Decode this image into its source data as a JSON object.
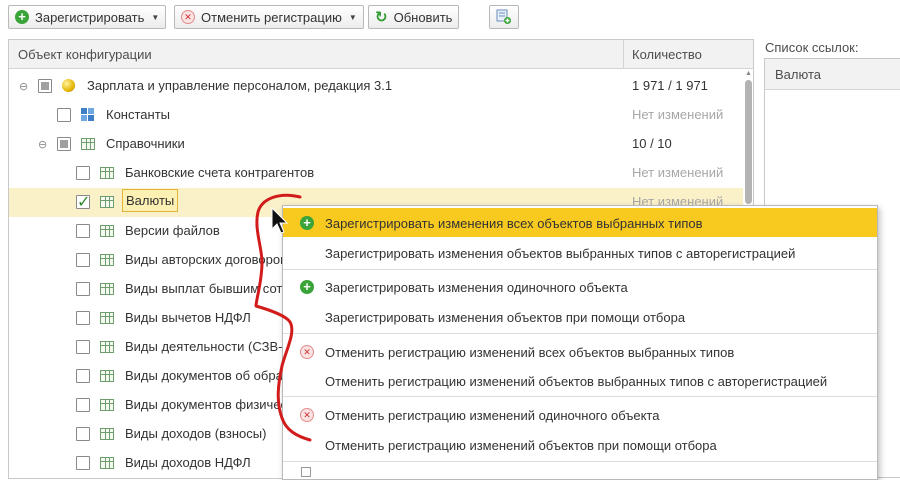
{
  "toolbar": {
    "register_label": "Зарегистрировать",
    "cancel_registration_label": "Отменить регистрацию",
    "refresh_label": "Обновить",
    "extra_icon": "settings-object-icon"
  },
  "tree": {
    "columns": {
      "object": "Объект конфигурации",
      "quantity": "Количество"
    },
    "rows": [
      {
        "label": "Зарплата и управление персоналом, редакция 3.1",
        "qty": "1 971 / 1 971",
        "state": "partial"
      },
      {
        "label": "Константы",
        "qty": "Нет изменений",
        "state": "unchecked"
      },
      {
        "label": "Справочники",
        "qty": "10 / 10",
        "state": "partial"
      },
      {
        "label": "Банковские счета контрагентов",
        "qty": "Нет изменений",
        "state": "unchecked"
      },
      {
        "label": "Валюты",
        "qty": "Нет изменений",
        "state": "checked"
      },
      {
        "label": "Версии файлов",
        "qty": "",
        "state": "unchecked"
      },
      {
        "label": "Виды авторских договоров",
        "qty": "",
        "state": "unchecked"
      },
      {
        "label": "Виды выплат бывшим сотрудникам",
        "qty": "",
        "state": "unchecked"
      },
      {
        "label": "Виды вычетов НДФЛ",
        "qty": "",
        "state": "unchecked"
      },
      {
        "label": "Виды деятельности (СЗВ-К)",
        "qty": "",
        "state": "unchecked"
      },
      {
        "label": "Виды документов об образовании",
        "qty": "",
        "state": "unchecked"
      },
      {
        "label": "Виды документов физических лиц",
        "qty": "",
        "state": "unchecked"
      },
      {
        "label": "Виды доходов (взносы)",
        "qty": "",
        "state": "unchecked"
      },
      {
        "label": "Виды доходов НДФЛ",
        "qty": "",
        "state": "unchecked"
      }
    ]
  },
  "references": {
    "title": "Список ссылок:",
    "column": "Валюта"
  },
  "context_menu": {
    "items": [
      {
        "label": "Зарегистрировать изменения всех объектов выбранных типов",
        "icon": "plus-icon"
      },
      {
        "label": "Зарегистрировать изменения объектов выбранных типов с авторегистрацией",
        "icon": ""
      },
      {
        "label": "Зарегистрировать изменения одиночного объекта",
        "icon": "plus-icon"
      },
      {
        "label": "Зарегистрировать изменения объектов при помощи отбора",
        "icon": ""
      },
      {
        "label": "Отменить регистрацию изменений всех объектов выбранных типов",
        "icon": "cancel-icon"
      },
      {
        "label": "Отменить регистрацию изменений объектов выбранных типов с авторегистрацией",
        "icon": ""
      },
      {
        "label": "Отменить регистрацию изменений одиночного объекта",
        "icon": "cancel-icon"
      },
      {
        "label": "Отменить регистрацию изменений объектов при помощи отбора",
        "icon": ""
      }
    ]
  },
  "colors": {
    "menu_highlight": "#f8c91f",
    "selected_row": "#fbf1c8",
    "annotation": "#d21c1c"
  }
}
